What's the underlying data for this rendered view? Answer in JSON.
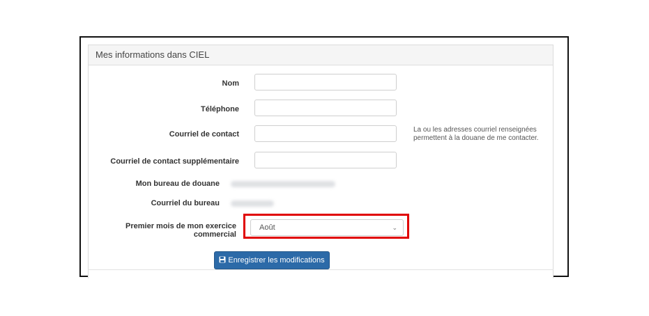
{
  "panel": {
    "title": "Mes informations dans CIEL"
  },
  "fields": {
    "nom": {
      "label": "Nom",
      "value": ""
    },
    "telephone": {
      "label": "Téléphone",
      "value": ""
    },
    "courriel_contact": {
      "label": "Courriel de contact",
      "value": ""
    },
    "courriel_supplementaire": {
      "label": "Courriel de contact supplémentaire",
      "value": ""
    },
    "bureau_douane": {
      "label": "Mon bureau de douane"
    },
    "courriel_bureau": {
      "label": "Courriel du bureau"
    },
    "premier_mois": {
      "label": "Premier mois de mon exercice commercial",
      "selected": "Août"
    }
  },
  "help": {
    "contact": "La ou les adresses courriel renseignées permettent à la douane de me contacter."
  },
  "actions": {
    "save_label": "Enregistrer les modifications",
    "save_icon": "floppy-disk-icon"
  },
  "colors": {
    "highlight": "#e00000",
    "primary_button": "#2c6aa8"
  }
}
